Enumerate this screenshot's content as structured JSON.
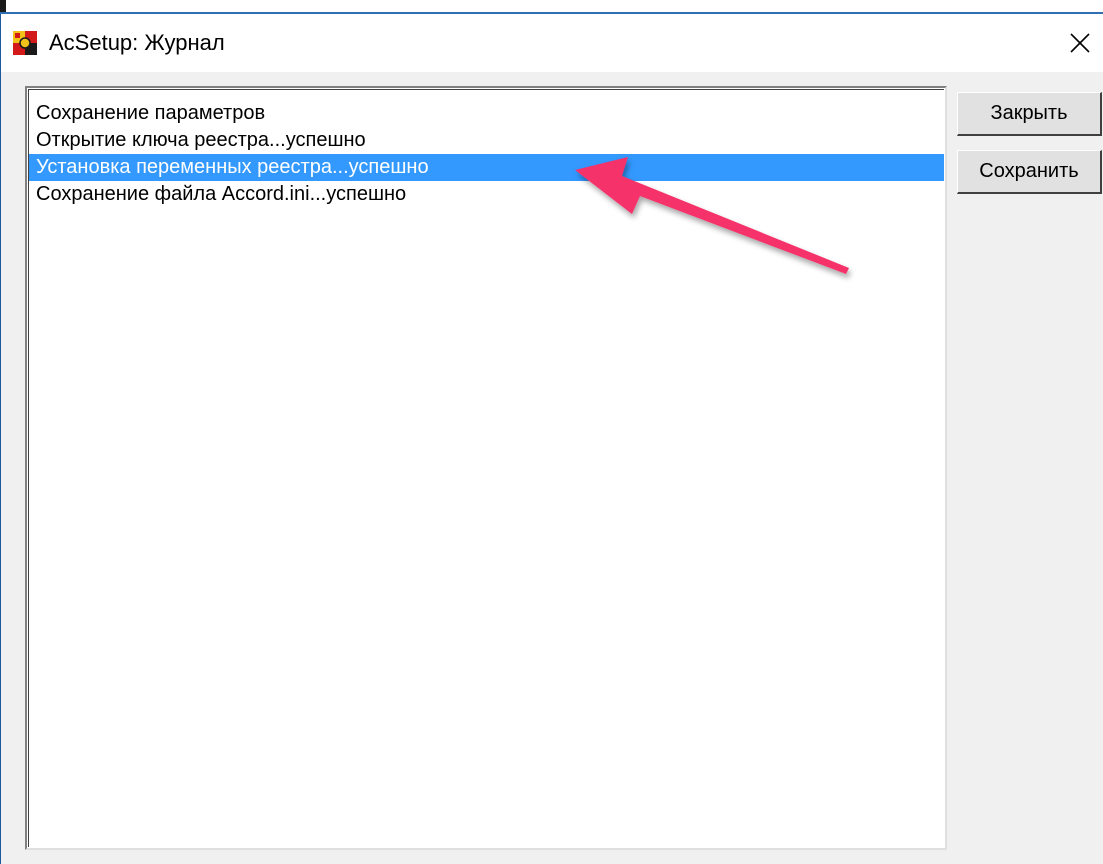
{
  "window": {
    "title": "AcSetup: Журнал",
    "icon": "acsetup-app-icon",
    "close_icon": "close-icon"
  },
  "log": {
    "items": [
      "Сохранение параметров",
      "Открытие ключа реестра...успешно",
      "Установка переменных реестра...успешно",
      "Сохранение файла Accord.ini...успешно"
    ],
    "selected_index": 2
  },
  "buttons": {
    "close_label": "Закрыть",
    "save_label": "Сохранить"
  },
  "annotation": {
    "arrow_color": "#f5306a",
    "points_to": "log.items.2"
  },
  "colors": {
    "selection": "#3399ff",
    "face": "#f0f0f0",
    "accent": "#2f6eb3"
  }
}
